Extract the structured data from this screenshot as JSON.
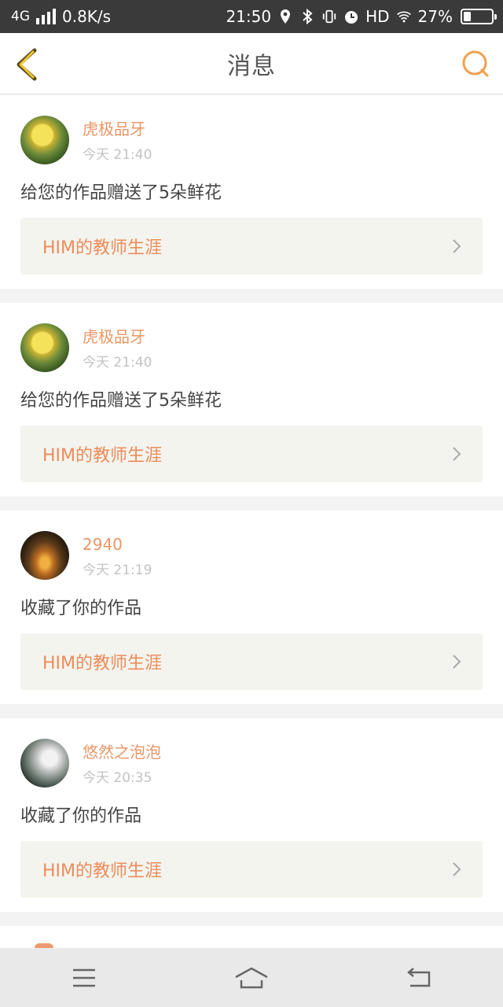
{
  "status_bar": {
    "network": "4G",
    "speed": "0.8K/s",
    "time": "21:50",
    "hd": "HD",
    "battery": "27%",
    "battery_level": 0.27,
    "icons": [
      "signal-icon",
      "location-icon",
      "bluetooth-icon",
      "vibrate-icon",
      "alarm-icon",
      "wifi-icon",
      "battery-icon"
    ]
  },
  "header": {
    "title": "消息",
    "back_icon": "chevron-left-icon",
    "search_icon": "search-icon",
    "accent_color": "#f0a04a"
  },
  "messages": [
    {
      "user": "虎极品牙",
      "time": "今天 21:40",
      "action": "给您的作品赠送了5朵鲜花",
      "work": "HIM的教师生涯"
    },
    {
      "user": "虎极品牙",
      "time": "今天 21:40",
      "action": "给您的作品赠送了5朵鲜花",
      "work": "HIM的教师生涯"
    },
    {
      "user": "2940",
      "time": "今天 21:19",
      "action": "收藏了你的作品",
      "work": "HIM的教师生涯"
    },
    {
      "user": "悠然之泡泡",
      "time": "今天 20:35",
      "action": "收藏了你的作品",
      "work": "HIM的教师生涯"
    }
  ],
  "colors": {
    "username": "#e99766",
    "work_title": "#ec8c5a",
    "link_bg": "#f4f4ee"
  },
  "nav": {
    "icons": [
      "menu-icon",
      "home-icon",
      "back-icon"
    ]
  }
}
